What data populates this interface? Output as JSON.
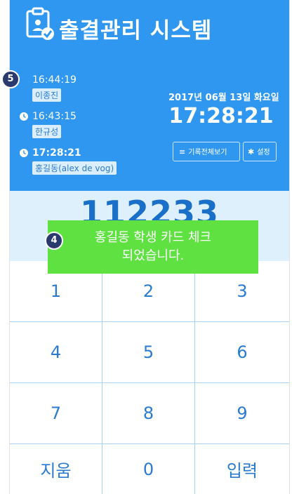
{
  "app": {
    "title": "출결관리 시스템"
  },
  "log": [
    {
      "time": "16:44:19",
      "name": "이종진"
    },
    {
      "time": "16:43:15",
      "name": "한규성"
    },
    {
      "time": "17:28:21",
      "name": "홍길동(alex de vog)"
    }
  ],
  "clock": {
    "date": "2017년 06월 13일 화요일",
    "time": "17:28:21"
  },
  "buttons": {
    "view_all": "기록전체보기",
    "settings": "설정"
  },
  "entry": {
    "value": "112233"
  },
  "keypad": {
    "keys": [
      "1",
      "2",
      "3",
      "4",
      "5",
      "6",
      "7",
      "8",
      "9",
      "지움",
      "0",
      "입력"
    ]
  },
  "toast": {
    "line1": "홍길동 학생 카드 체크",
    "line2": "되었습니다."
  },
  "callouts": {
    "badge5": "5",
    "badge4": "4"
  },
  "colors": {
    "header": "#2f97f0",
    "display": "#ddf0fb",
    "toast": "#5fe241",
    "key_text": "#2a7bd0"
  },
  "icons": {
    "logo": "clipboard-check-icon",
    "clock": "clock-icon",
    "list": "list-icon",
    "gear": "gear-icon"
  }
}
